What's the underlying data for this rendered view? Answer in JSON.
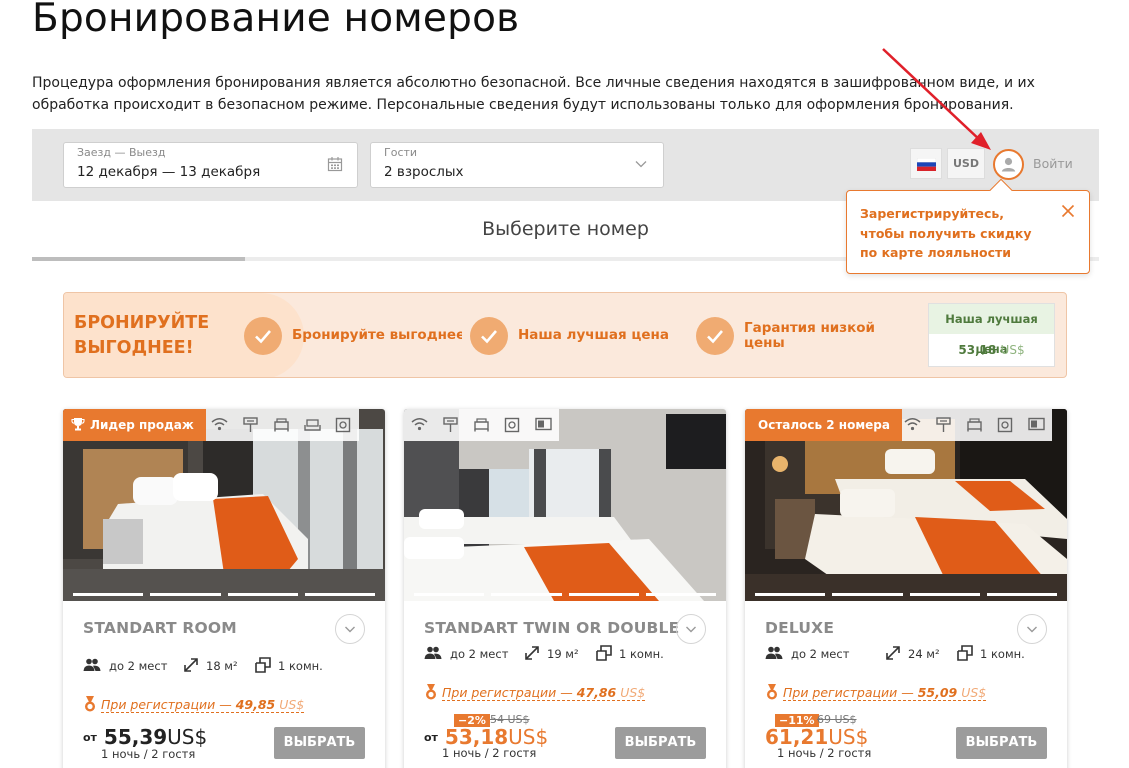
{
  "page": {
    "title": "Бронирование номеров",
    "intro": "Процедура оформления бронирования является абсолютно безопасной. Все личные сведения находятся в зашифрованном виде, и их обработка происходит в безопасном режиме. Персональные сведения будут использованы только для оформления бронирования."
  },
  "search": {
    "dates_label": "Заезд — Выезд",
    "dates_value": "12 декабря — 13 декабря",
    "guests_label": "Гости",
    "guests_value": "2 взрослых",
    "currency": "USD",
    "login": "Войти"
  },
  "tooltip": {
    "message": "Зарегистрируйтесь, чтобы получить скидку по карте лояльности"
  },
  "section": {
    "heading": "Выберите номер"
  },
  "promo": {
    "headline": "БРОНИРУЙТЕ ВЫГОДНЕЕ!",
    "benefits": [
      "Бронируйте выгоднее",
      "Наша лучшая цена",
      "Гарантия низкой цены"
    ],
    "best_price_label": "Наша лучшая цена",
    "best_price_value": "53,18",
    "best_price_currency": "US$"
  },
  "rooms": [
    {
      "badge": "Лидер продаж",
      "name": "STANDART ROOM",
      "guests": "до 2 мест",
      "area": "18 м²",
      "rooms": "1 комн.",
      "reg_text": "При регистрации — ",
      "reg_price": "49,85",
      "reg_currency": "US$",
      "discount": "",
      "old_price": "",
      "from": "от",
      "price": "55,39",
      "currency": "US$",
      "nights": "1 ночь / 2 гостя",
      "button": "ВЫБРАТЬ"
    },
    {
      "badge": "",
      "name": "STANDART TWIN OR DOUBLE",
      "guests": "до 2 мест",
      "area": "19 м²",
      "rooms": "1 комн.",
      "reg_text": "При регистрации — ",
      "reg_price": "47,86",
      "reg_currency": "US$",
      "discount": "−2%",
      "old_price": "54 US$",
      "from": "от",
      "price": "53,18",
      "currency": "US$",
      "nights": "1 ночь / 2 гостя",
      "button": "ВЫБРАТЬ"
    },
    {
      "badge": "Осталось 2 номера",
      "name": "DELUXE",
      "guests": "до 2 мест",
      "area": "24 м²",
      "rooms": "1 комн.",
      "reg_text": "При регистрации — ",
      "reg_price": "55,09",
      "reg_currency": "US$",
      "discount": "−11%",
      "old_price": "69 US$",
      "from": "",
      "price": "61,21",
      "currency": "US$",
      "nights": "1 ночь / 2 гостя",
      "button": "ВЫБРАТЬ"
    }
  ],
  "colors": {
    "accent": "#e8792f",
    "best_price_green": "#4f7a3d",
    "button_gray": "#9c9c9c",
    "annotation_arrow": "#e0202a"
  }
}
